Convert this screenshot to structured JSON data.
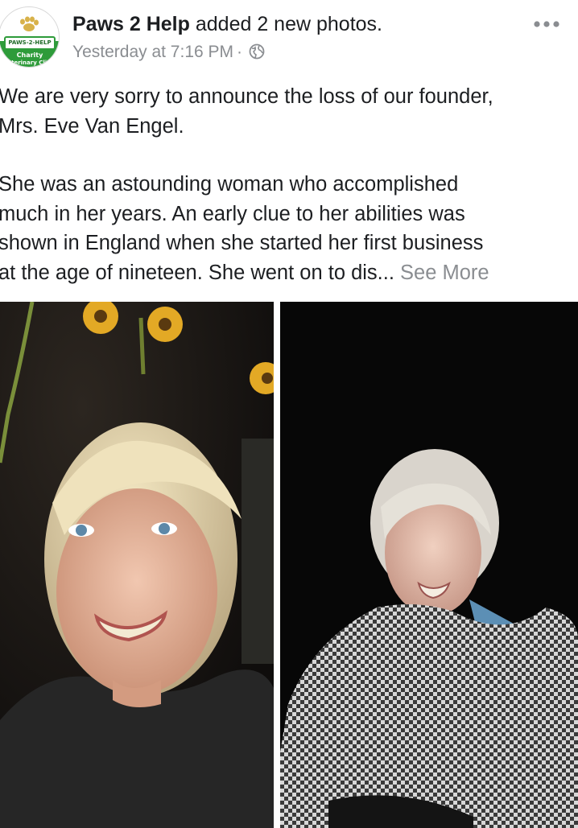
{
  "post": {
    "author": "Paws 2 Help",
    "action": "added 2 new photos.",
    "timestamp": "Yesterday at 7:16 PM",
    "separator": "·",
    "audience_icon": "globe-icon",
    "more_icon": "more-options-icon",
    "avatar": {
      "logo_badge": "PAWS-2-HELP",
      "logo_line1": "Charity",
      "logo_line2": "Veterinary Clinic"
    },
    "text_lines": [
      "We are very sorry to announce the loss of our founder,",
      "Mrs. Eve Van Engel.",
      "She was an astounding woman who accomplished",
      "much in her years. An early clue to her abilities was",
      "shown in England when she started her first business",
      "at the age of nineteen.  She went on to dis..."
    ],
    "see_more": "See More",
    "photos": [
      {
        "description_icon": "photo-portrait-sunflowers"
      },
      {
        "description_icon": "photo-portrait-dark-background"
      }
    ]
  },
  "colors": {
    "text": "#1c1e21",
    "secondary_text": "#8a8d91",
    "logo_green": "#2e9b3a"
  }
}
